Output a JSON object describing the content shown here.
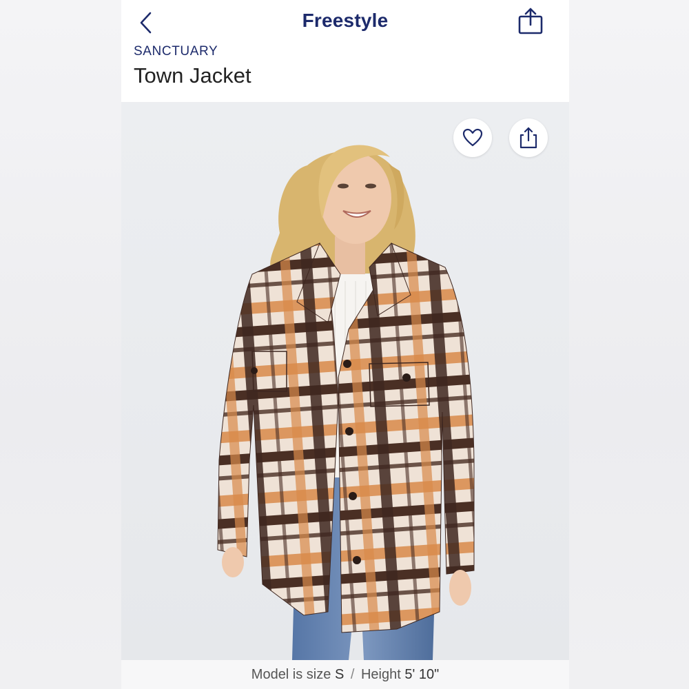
{
  "nav": {
    "title": "Freestyle",
    "back_icon": "chevron-left-icon",
    "share_icon": "share-icon"
  },
  "product": {
    "brand": "SANCTUARY",
    "name": "Town Jacket"
  },
  "image": {
    "favorite_icon": "heart-icon",
    "share_icon": "share-icon",
    "description": "Smiling woman with wavy blonde hair wearing a brown, cream and orange plaid shirt jacket over a white ribbed top and blue jeans"
  },
  "caption": {
    "size_label": "Model is size",
    "size_value": "S",
    "separator": "/",
    "height_label": "Height",
    "height_value": "5' 10\""
  },
  "colors": {
    "brand_navy": "#1c2a6b",
    "jacket_brown": "#4a2f24",
    "jacket_orange": "#d98a4a",
    "jacket_cream": "#efe2d6",
    "denim": "#4f6f9f"
  }
}
